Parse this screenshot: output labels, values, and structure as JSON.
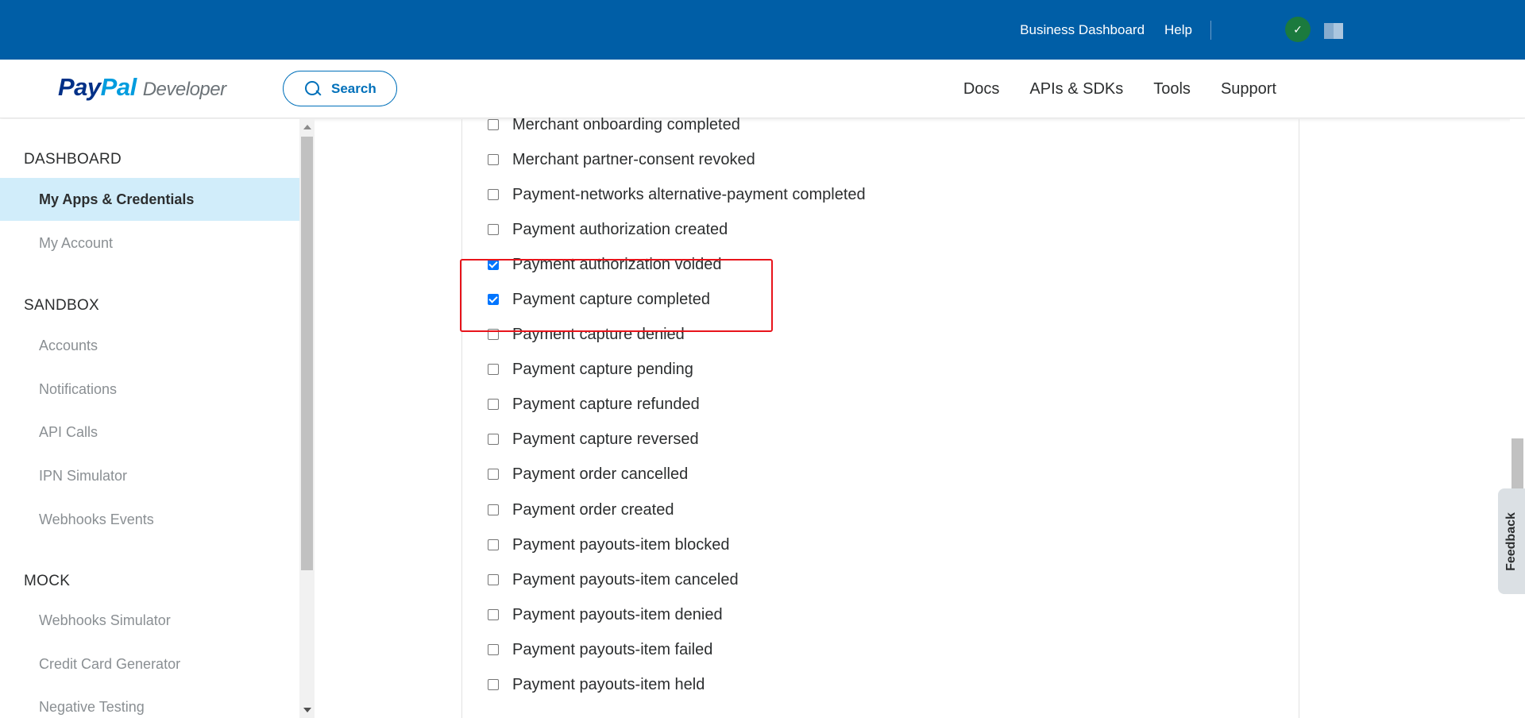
{
  "topbar": {
    "business_dashboard": "Business Dashboard",
    "help": "Help",
    "avatar_icon": "user-avatar-icon",
    "flag_icon": "country-flag-icon"
  },
  "header": {
    "logo_pay": "Pay",
    "logo_pal": "Pal",
    "logo_dev": "Developer",
    "search_label": "Search",
    "nav": [
      "Docs",
      "APIs & SDKs",
      "Tools",
      "Support"
    ]
  },
  "sidebar": {
    "dashboard_title": "DASHBOARD",
    "dashboard_items": [
      "My Apps & Credentials",
      "My Account"
    ],
    "sandbox_title": "SANDBOX",
    "sandbox_items": [
      "Accounts",
      "Notifications",
      "API Calls",
      "IPN Simulator",
      "Webhooks Events"
    ],
    "mock_title": "MOCK",
    "mock_items": [
      "Webhooks Simulator",
      "Credit Card Generator",
      "Negative Testing"
    ]
  },
  "events": [
    {
      "label": "Merchant onboarding completed",
      "checked": false
    },
    {
      "label": "Merchant partner-consent revoked",
      "checked": false
    },
    {
      "label": "Payment-networks alternative-payment completed",
      "checked": false
    },
    {
      "label": "Payment authorization created",
      "checked": false
    },
    {
      "label": "Payment authorization voided",
      "checked": true
    },
    {
      "label": "Payment capture completed",
      "checked": true
    },
    {
      "label": "Payment capture denied",
      "checked": false
    },
    {
      "label": "Payment capture pending",
      "checked": false
    },
    {
      "label": "Payment capture refunded",
      "checked": false
    },
    {
      "label": "Payment capture reversed",
      "checked": false
    },
    {
      "label": "Payment order cancelled",
      "checked": false
    },
    {
      "label": "Payment order created",
      "checked": false
    },
    {
      "label": "Payment payouts-item blocked",
      "checked": false
    },
    {
      "label": "Payment payouts-item canceled",
      "checked": false
    },
    {
      "label": "Payment payouts-item denied",
      "checked": false
    },
    {
      "label": "Payment payouts-item failed",
      "checked": false
    },
    {
      "label": "Payment payouts-item held",
      "checked": false
    }
  ],
  "feedback_label": "Feedback"
}
